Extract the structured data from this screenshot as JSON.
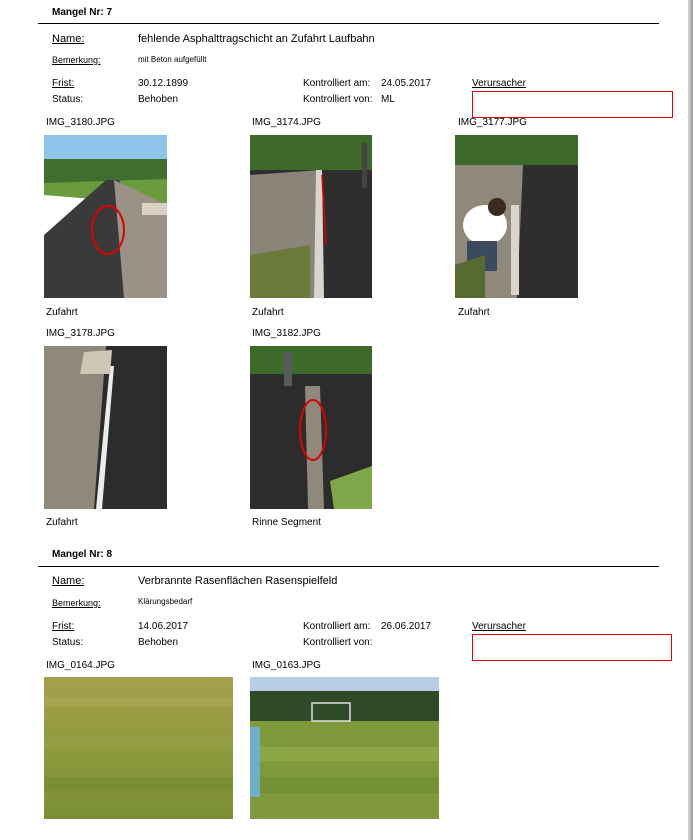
{
  "defects": [
    {
      "title": "Mangel Nr: 7",
      "name_label": "Name:",
      "name_value": "fehlende Asphalttragschicht an Zufahrt Laufbahn",
      "remark_label": "Bemerkung:",
      "remark_value": "mit Beton aufgefüllt",
      "deadline_label": "Frist:",
      "deadline_value": "30.12.1899",
      "checked_on_label": "Kontrolliert am:",
      "checked_on_value": "24.05.2017",
      "cause_label": "Verursacher",
      "status_label": "Status:",
      "status_value": "Behoben",
      "checked_by_label": "Kontrolliert von:",
      "checked_by_value": "ML",
      "photos": [
        {
          "file": "IMG_3180.JPG",
          "caption": "Zufahrt"
        },
        {
          "file": "IMG_3174.JPG",
          "caption": "Zufahrt"
        },
        {
          "file": "IMG_3177.JPG",
          "caption": "Zufahrt"
        },
        {
          "file": "IMG_3178.JPG",
          "caption": "Zufahrt"
        },
        {
          "file": "IMG_3182.JPG",
          "caption": "Rinne Segment"
        }
      ]
    },
    {
      "title": "Mangel Nr: 8",
      "name_label": "Name:",
      "name_value": "Verbrannte Rasenflächen Rasenspielfeld",
      "remark_label": "Bemerkung:",
      "remark_value": "Klärungsbedarf",
      "deadline_label": "Frist:",
      "deadline_value": "14.06.2017",
      "checked_on_label": "Kontrolliert am:",
      "checked_on_value": "26.06.2017",
      "cause_label": "Verursacher",
      "status_label": "Status:",
      "status_value": "Behoben",
      "checked_by_label": "Kontrolliert von:",
      "checked_by_value": "",
      "photos": [
        {
          "file": "IMG_0164.JPG",
          "caption": ""
        },
        {
          "file": "IMG_0163.JPG",
          "caption": ""
        }
      ]
    }
  ],
  "colors": {
    "highlight_box": "#e00000",
    "rule": "#000000"
  }
}
